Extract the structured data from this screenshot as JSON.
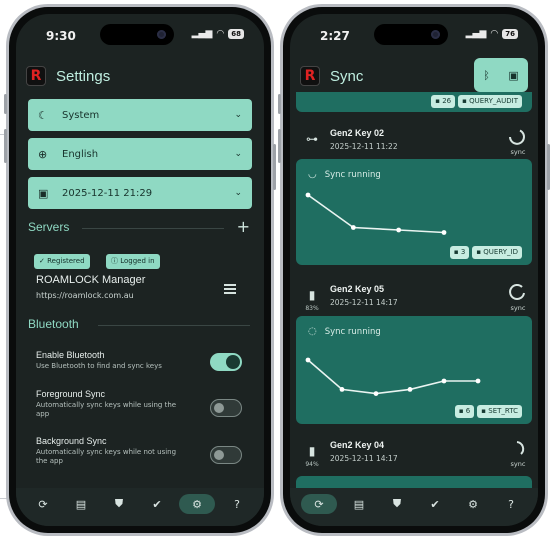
{
  "left_phone": {
    "status": {
      "time": "9:30",
      "battery": "68"
    },
    "app_title": "Settings",
    "theme_select": {
      "value": "System"
    },
    "language_select": {
      "value": "English"
    },
    "date_select": {
      "value": "2025-12-11 21:29"
    },
    "servers": {
      "heading": "Servers",
      "add_icon": "+",
      "chips": [
        "Registered",
        "Logged in"
      ],
      "server_name": "ROAMLOCK Manager",
      "server_url": "https://roamlock.com.au"
    },
    "bluetooth": {
      "heading": "Bluetooth",
      "settings": [
        {
          "title": "Enable Bluetooth",
          "desc": "Use Bluetooth to find and sync keys",
          "on": true
        },
        {
          "title": "Foreground Sync",
          "desc": "Automatically sync keys while using the app",
          "on": false
        },
        {
          "title": "Background Sync",
          "desc": "Automatically sync keys while not using the app",
          "on": false
        }
      ]
    },
    "nav": [
      "sync-icon",
      "keys-icon",
      "shield-icon",
      "check-icon",
      "gear-icon",
      "help-icon"
    ],
    "active_nav": "gear-icon"
  },
  "right_phone": {
    "status": {
      "time": "2:27",
      "battery": "76"
    },
    "app_title": "Sync",
    "toolbar_icons": [
      "bluetooth-icon",
      "scan-icon"
    ],
    "top_card": {
      "count": "26",
      "type": "QUERY_AUDIT"
    },
    "keys": [
      {
        "name": "Gen2 Key 02",
        "date": "2025-12-11 11:22",
        "status": "sync",
        "battery": "",
        "icon": "key-icon"
      },
      {
        "name": "Gen2 Key 05",
        "date": "2025-12-11 14:17",
        "status": "sync",
        "battery": "83%",
        "icon": "battery-icon"
      },
      {
        "name": "Gen2 Key 04",
        "date": "2025-12-11 14:17",
        "status": "sync",
        "battery": "94%",
        "icon": "battery-icon"
      }
    ],
    "running_cards": [
      {
        "title": "Sync running",
        "count": "3",
        "type": "QUERY_ID",
        "series": [
          1.0,
          0.35,
          0.3,
          0.25
        ]
      },
      {
        "title": "Sync running",
        "count": "6",
        "type": "SET_RTC",
        "series": [
          1.0,
          0.3,
          0.2,
          0.3,
          0.5,
          0.5
        ]
      }
    ],
    "nav": [
      "sync-icon",
      "keys-icon",
      "shield-icon",
      "check-icon",
      "gear-icon",
      "help-icon"
    ],
    "active_nav": "sync-icon"
  },
  "colors": {
    "accent": "#8fd9c3",
    "card": "#1f6e61",
    "background": "#1c2322",
    "logo_red": "#e02222"
  }
}
